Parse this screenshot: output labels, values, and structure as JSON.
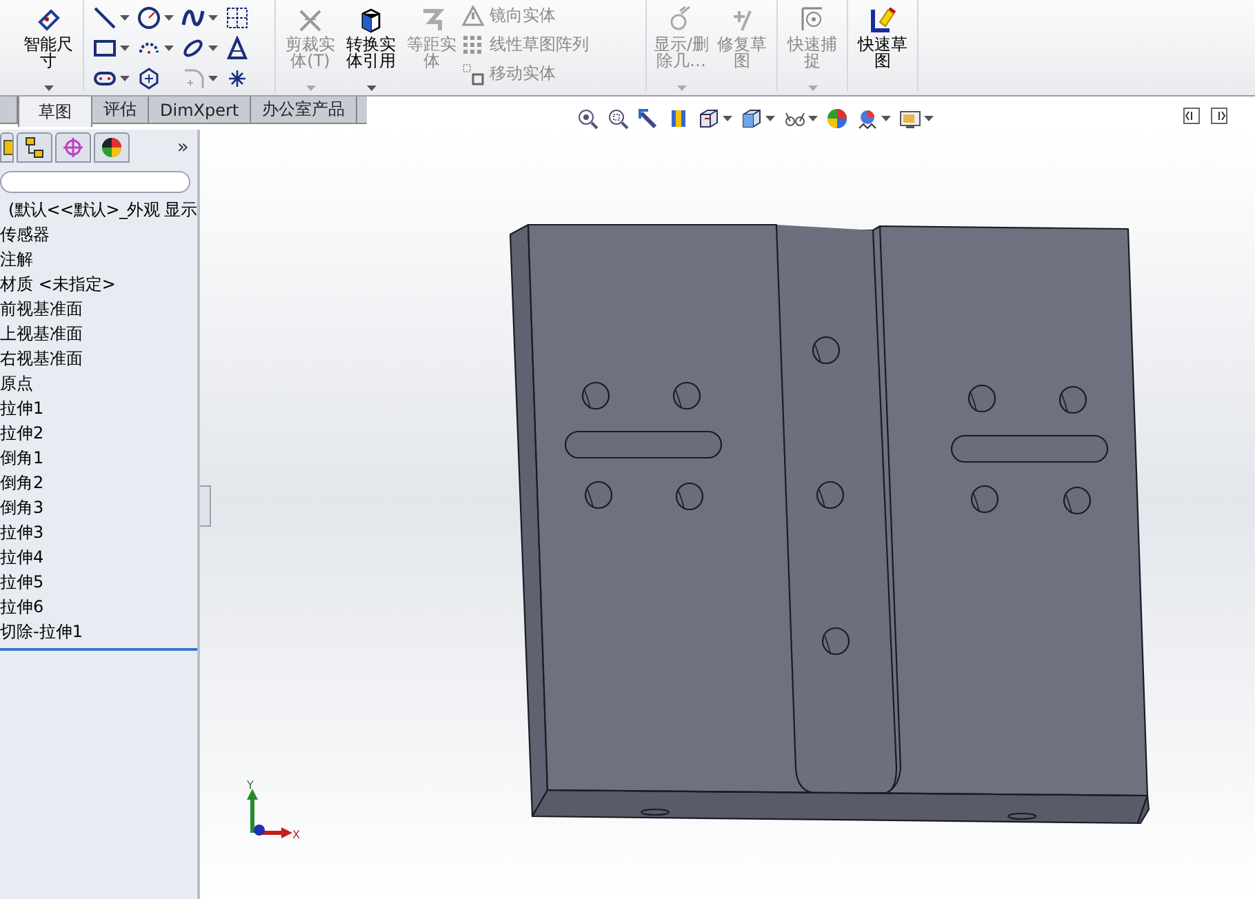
{
  "ribbon": {
    "groups": [
      {
        "items": [
          {
            "kind": "large",
            "label": "智能尺寸",
            "disabled": false,
            "dropdown": true
          }
        ]
      },
      {
        "items": [
          {
            "kind": "large",
            "label": "剪裁实体(T)",
            "disabled": true,
            "dropdown": true
          },
          {
            "kind": "large",
            "label": "转换实体引用",
            "disabled": false,
            "dropdown": true
          },
          {
            "kind": "large",
            "label": "等距实体",
            "disabled": true,
            "dropdown": false
          },
          {
            "kind": "small",
            "label": "镜向实体",
            "disabled": true
          },
          {
            "kind": "small",
            "label": "线性草图阵列",
            "disabled": true
          },
          {
            "kind": "small",
            "label": "移动实体",
            "disabled": true
          }
        ]
      },
      {
        "items": [
          {
            "kind": "large",
            "label": "显示/删除几…",
            "disabled": true,
            "dropdown": true
          },
          {
            "kind": "large",
            "label": "修复草图",
            "disabled": true,
            "dropdown": false
          }
        ]
      },
      {
        "items": [
          {
            "kind": "large",
            "label": "快速捕捉",
            "disabled": true,
            "dropdown": true
          }
        ]
      },
      {
        "items": [
          {
            "kind": "large",
            "label": "快速草图",
            "disabled": false,
            "dropdown": false
          }
        ]
      }
    ]
  },
  "tabs": [
    {
      "label": "草图",
      "selected": true
    },
    {
      "label": "评估",
      "selected": false
    },
    {
      "label": "DimXpert",
      "selected": false
    },
    {
      "label": "办公室产品",
      "selected": false
    }
  ],
  "feature_manager": {
    "more": "»",
    "tree": [
      {
        "label": "(默认<<默认>_外观 显示"
      },
      {
        "label": "传感器"
      },
      {
        "label": "注解"
      },
      {
        "label": "材质 <未指定>"
      },
      {
        "label": "前视基准面"
      },
      {
        "label": "上视基准面"
      },
      {
        "label": "右视基准面"
      },
      {
        "label": "原点"
      },
      {
        "label": "拉伸1"
      },
      {
        "label": "拉伸2"
      },
      {
        "label": "倒角1"
      },
      {
        "label": "倒角2"
      },
      {
        "label": "倒角3"
      },
      {
        "label": "拉伸3"
      },
      {
        "label": "拉伸4"
      },
      {
        "label": "拉伸5"
      },
      {
        "label": "拉伸6"
      },
      {
        "label": "切除-拉伸1"
      }
    ]
  },
  "triad": {
    "y_label": "Y",
    "x_label": "X"
  }
}
